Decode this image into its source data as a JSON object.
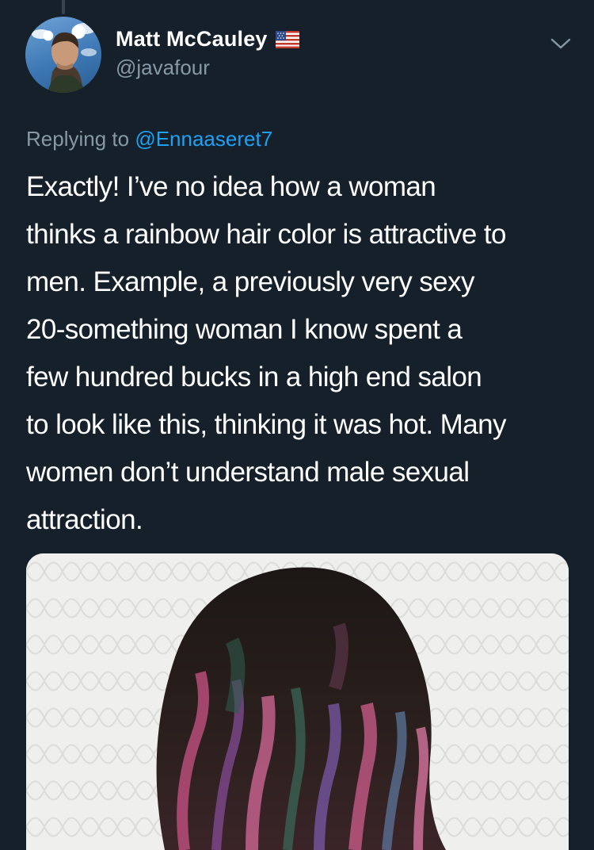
{
  "tweet": {
    "author": {
      "name": "Matt McCauley",
      "handle": "@javafour",
      "flag_icon": "us-flag-icon"
    },
    "reply_prefix": "Replying to ",
    "reply_to": "@Ennaaseret7",
    "text": "Exactly! I’ve no idea how a woman\nthinks a rainbow hair color is attractive to\nmen. Example, a previously very sexy\n20-something woman I know spent a\nfew hundred bucks in a high end salon\nto look like this, thinking it was hot. Many\nwomen don’t understand male sexual\nattraction.",
    "more_icon": "chevron-down-icon",
    "media": {
      "type": "photo",
      "subject": "dark hair with pink and purple rainbow highlights"
    }
  },
  "colors": {
    "background": "#15202b",
    "text_primary": "#ffffff",
    "text_secondary": "#8899a6",
    "link": "#1da1f2"
  }
}
